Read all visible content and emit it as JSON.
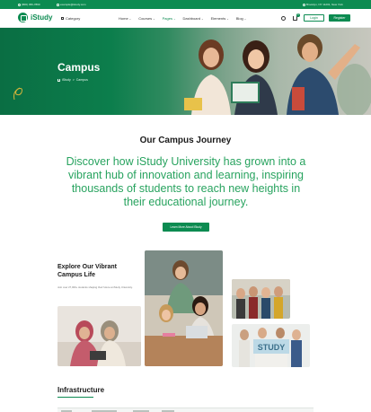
{
  "topbar": {
    "phone": "(800) 456-7890",
    "email": "example@istudy.com",
    "address": "Brooklyn, NY 11201, New York"
  },
  "header": {
    "logo": "iStudy",
    "category": "Category",
    "nav": [
      {
        "label": "Home",
        "active": false
      },
      {
        "label": "Courses",
        "active": false
      },
      {
        "label": "Pages",
        "active": true
      },
      {
        "label": "Dashboard",
        "active": false
      },
      {
        "label": "Elements",
        "active": false
      },
      {
        "label": "Blog",
        "active": false
      }
    ],
    "cart_count": "0",
    "login": "Login",
    "register": "Register"
  },
  "hero": {
    "title": "Campus",
    "breadcrumb": [
      "iStudy",
      ">",
      "Campus"
    ]
  },
  "journey": {
    "title": "Our Campus Journey",
    "text": "Discover how iStudy University has grown into a vibrant hub of innovation and learning, inspiring thousands of students to reach new heights in their educational journey.",
    "button": "Learn More About iStudy"
  },
  "campus_life": {
    "title": "Explore Our Vibrant Campus Life",
    "text": "Join over 27,000+ students shaping their future at iStudy University.",
    "study_sign": "STUDY"
  },
  "infrastructure": {
    "title": "Infrastructure"
  },
  "colors": {
    "brand": "#0c8b51",
    "accent_text": "#28a35f"
  }
}
